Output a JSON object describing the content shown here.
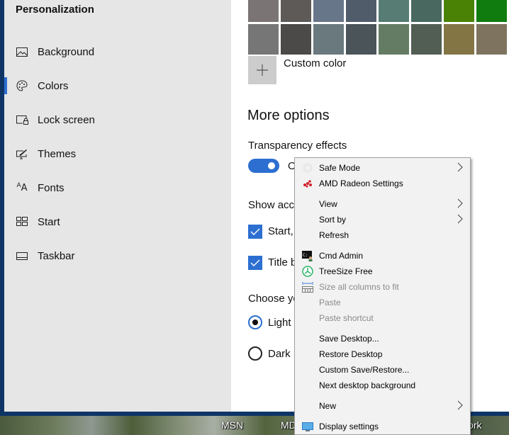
{
  "sidebar": {
    "title": "Personalization",
    "items": [
      {
        "label": "Background",
        "icon": "picture-icon"
      },
      {
        "label": "Colors",
        "icon": "palette-icon",
        "active": true
      },
      {
        "label": "Lock screen",
        "icon": "lock-screen-icon"
      },
      {
        "label": "Themes",
        "icon": "themes-brush-icon"
      },
      {
        "label": "Fonts",
        "icon": "fonts-icon"
      },
      {
        "label": "Start",
        "icon": "start-tiles-icon"
      },
      {
        "label": "Taskbar",
        "icon": "taskbar-icon"
      }
    ]
  },
  "colors": {
    "swatches_row1": [
      "#7a7574",
      "#5d5a58",
      "#68768a",
      "#515c6b",
      "#567c73",
      "#486860",
      "#498205",
      "#107c10"
    ],
    "swatches_row2": [
      "#767676",
      "#4c4a48",
      "#69797e",
      "#4a5459",
      "#647c64",
      "#525e54",
      "#847545",
      "#7e735f"
    ],
    "custom_color_label": "Custom color"
  },
  "more_options": {
    "title": "More options",
    "transparency_label": "Transparency effects",
    "transparency_value": "On",
    "transparency_on": true,
    "accent_label": "Show accent color on the following surfaces",
    "checkboxes": [
      {
        "label": "Start, taskbar, and action center",
        "checked": true
      },
      {
        "label": "Title bars",
        "checked": true
      }
    ],
    "mode_label": "Choose your default app mode",
    "radios": [
      {
        "label": "Light",
        "checked": true
      },
      {
        "label": "Dark",
        "checked": false
      }
    ]
  },
  "desktop": {
    "labels": [
      "MSN",
      "MD",
      "Network"
    ]
  },
  "context_menu": {
    "items": [
      {
        "label": "Safe Mode",
        "icon": "gear-icon",
        "submenu": true,
        "disabled": false
      },
      {
        "label": "AMD Radeon Settings",
        "icon": "amd-radeon-icon",
        "submenu": false,
        "disabled": false
      },
      {
        "label": "View",
        "submenu": true,
        "disabled": false
      },
      {
        "label": "Sort by",
        "submenu": true,
        "disabled": false
      },
      {
        "label": "Refresh",
        "submenu": false,
        "disabled": false
      },
      {
        "label": "Cmd Admin",
        "icon": "cmd-admin-icon",
        "submenu": false,
        "disabled": false
      },
      {
        "label": "TreeSize Free",
        "icon": "treesize-icon",
        "submenu": false,
        "disabled": false
      },
      {
        "label": "Size all columns to fit",
        "icon": "columns-fit-icon",
        "submenu": false,
        "disabled": true
      },
      {
        "label": "Paste",
        "submenu": false,
        "disabled": true
      },
      {
        "label": "Paste shortcut",
        "submenu": false,
        "disabled": true
      },
      {
        "label": "Save Desktop...",
        "submenu": false,
        "disabled": false
      },
      {
        "label": "Restore Desktop",
        "submenu": false,
        "disabled": false
      },
      {
        "label": "Custom Save/Restore...",
        "submenu": false,
        "disabled": false
      },
      {
        "label": "Next desktop background",
        "submenu": false,
        "disabled": false
      },
      {
        "label": "New",
        "submenu": true,
        "disabled": false
      },
      {
        "label": "Display settings",
        "icon": "display-icon",
        "submenu": false,
        "disabled": false
      }
    ]
  }
}
